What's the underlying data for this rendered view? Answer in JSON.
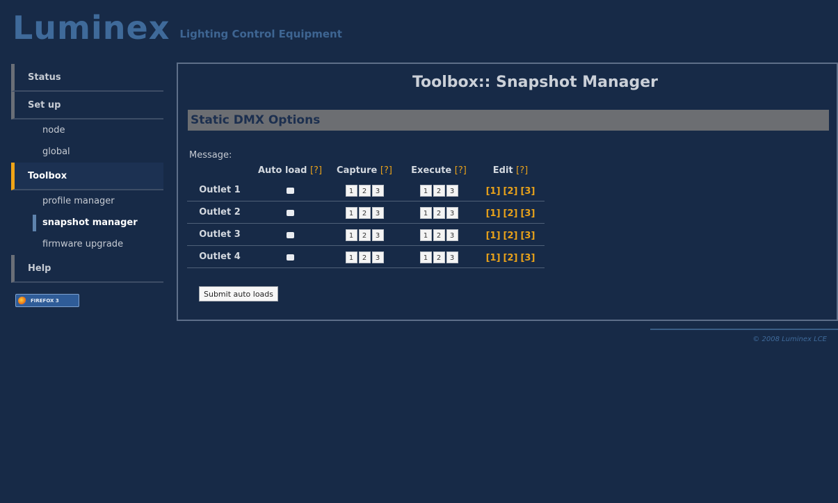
{
  "header": {
    "logo": "Luminex",
    "tagline": "Lighting Control Equipment"
  },
  "sidebar": {
    "items": [
      {
        "label": "Status"
      },
      {
        "label": "Set up"
      },
      {
        "label": "node"
      },
      {
        "label": "global"
      },
      {
        "label": "Toolbox"
      },
      {
        "label": "profile manager"
      },
      {
        "label": "snapshot manager"
      },
      {
        "label": "firmware upgrade"
      },
      {
        "label": "Help"
      }
    ],
    "badge": "FIREFOX 3"
  },
  "main": {
    "title": "Toolbox:: Snapshot Manager",
    "section": "Static DMX Options",
    "message_label": "Message:",
    "columns": {
      "auto_load": "Auto load",
      "capture": "Capture",
      "execute": "Execute",
      "edit": "Edit",
      "help": "[?]"
    },
    "buttons": [
      "1",
      "2",
      "3"
    ],
    "edit_links": [
      "[1]",
      "[2]",
      "[3]"
    ],
    "outlets": [
      "Outlet 1",
      "Outlet 2",
      "Outlet 3",
      "Outlet 4"
    ],
    "submit": "Submit auto loads"
  },
  "footer": {
    "copyright": "© 2008 Luminex LCE"
  },
  "colors": {
    "background": "#172a47",
    "accent": "#f0a417",
    "link": "#e9a21a",
    "brand": "#3f6a9a"
  }
}
